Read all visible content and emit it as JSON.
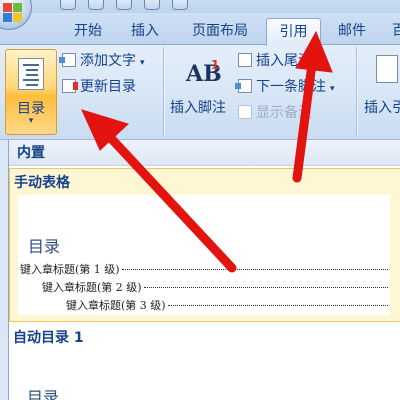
{
  "ribbon_tabs": [
    {
      "label": "开始",
      "active": false
    },
    {
      "label": "插入",
      "active": false
    },
    {
      "label": "页面布局",
      "active": false
    },
    {
      "label": "引用",
      "active": true
    },
    {
      "label": "邮件",
      "active": false
    },
    {
      "label": "百",
      "active": false
    }
  ],
  "toc_group": {
    "big_button_label": "目录",
    "add_text": "添加文字",
    "update_toc": "更新目录"
  },
  "footnote_group": {
    "insert_footnote": "插入脚注",
    "insert_endnote": "插入尾注",
    "next_footnote": "下一条脚注",
    "show_notes": "显示备注"
  },
  "caption_group": {
    "insert_caption": "插入引"
  },
  "gallery": {
    "section_builtin": "内置",
    "manual_table": {
      "title": "手动表格",
      "preview_heading": "目录",
      "lines": [
        "键入章标题(第 1 级)",
        "键入章标题(第 2 级)",
        "键入章标题(第 3 级)"
      ]
    },
    "auto_toc_1": {
      "title": "自动目录 1",
      "preview_heading": "目录"
    }
  },
  "colors": {
    "accent_orange": "#ffbe3c",
    "annotation_red": "#e3140f",
    "ribbon_text": "#15428b"
  }
}
